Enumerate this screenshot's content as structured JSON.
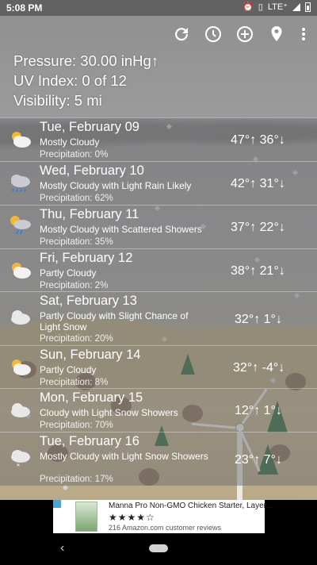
{
  "status": {
    "time": "5:08 PM",
    "network": "LTE⁺"
  },
  "toolbar": {
    "refresh": "refresh-icon",
    "history": "history-clock-icon",
    "add": "add-location-icon",
    "location": "location-pin-icon",
    "menu": "more-vert-icon"
  },
  "info": {
    "pressure": "Pressure: 30.00 inHg↑",
    "uv": "UV Index: 0 of 12",
    "visibility": "Visibility: 5 mi"
  },
  "forecast": [
    {
      "day": "Tue, February 09",
      "condition": "Mostly Cloudy",
      "precipitation": "Precipitation: 0%",
      "temps": "47°↑ 36°↓",
      "icon": "partly-cloudy-icon"
    },
    {
      "day": "Wed, February 10",
      "condition": "Mostly Cloudy with Light Rain Likely",
      "precipitation": "Precipitation: 62%",
      "temps": "42°↑ 31°↓",
      "icon": "cloud-rain-icon"
    },
    {
      "day": "Thu, February 11",
      "condition": "Mostly Cloudy with Scattered Showers",
      "precipitation": "Precipitation: 35%",
      "temps": "37°↑ 22°↓",
      "icon": "sun-cloud-showers-icon"
    },
    {
      "day": "Fri, February 12",
      "condition": "Partly Cloudy",
      "precipitation": "Precipitation: 2%",
      "temps": "38°↑ 21°↓",
      "icon": "partly-cloudy-icon"
    },
    {
      "day": "Sat, February 13",
      "condition": "Partly Cloudy with Slight Chance of Light Snow",
      "precipitation": "Precipitation: 20%",
      "temps": "32°↑ 1°↓",
      "icon": "cloud-icon"
    },
    {
      "day": "Sun, February 14",
      "condition": "Partly Cloudy",
      "precipitation": "Precipitation: 8%",
      "temps": "32°↑ -4°↓",
      "icon": "partly-cloudy-icon"
    },
    {
      "day": "Mon, February 15",
      "condition": "Cloudy with Light Snow Showers",
      "precipitation": "Precipitation: 70%",
      "temps": "12°↑ 1°↓",
      "icon": "cloud-icon"
    },
    {
      "day": "Tue, February 16",
      "condition": "Mostly Cloudy with Light Snow Showers",
      "precipitation": "Precipitation: 17%",
      "temps": "23°↑ 7°↓",
      "icon": "cloud-snow-icon"
    }
  ],
  "ad": {
    "title": "Manna Pro Non-GMO Chicken Starter, Layer...",
    "rating": 4,
    "reviews": "216 Amazon.com customer reviews"
  },
  "colors": {
    "row_bg": "#6e6e70",
    "text": "#ffffff",
    "tree": "#2f6b3c"
  }
}
